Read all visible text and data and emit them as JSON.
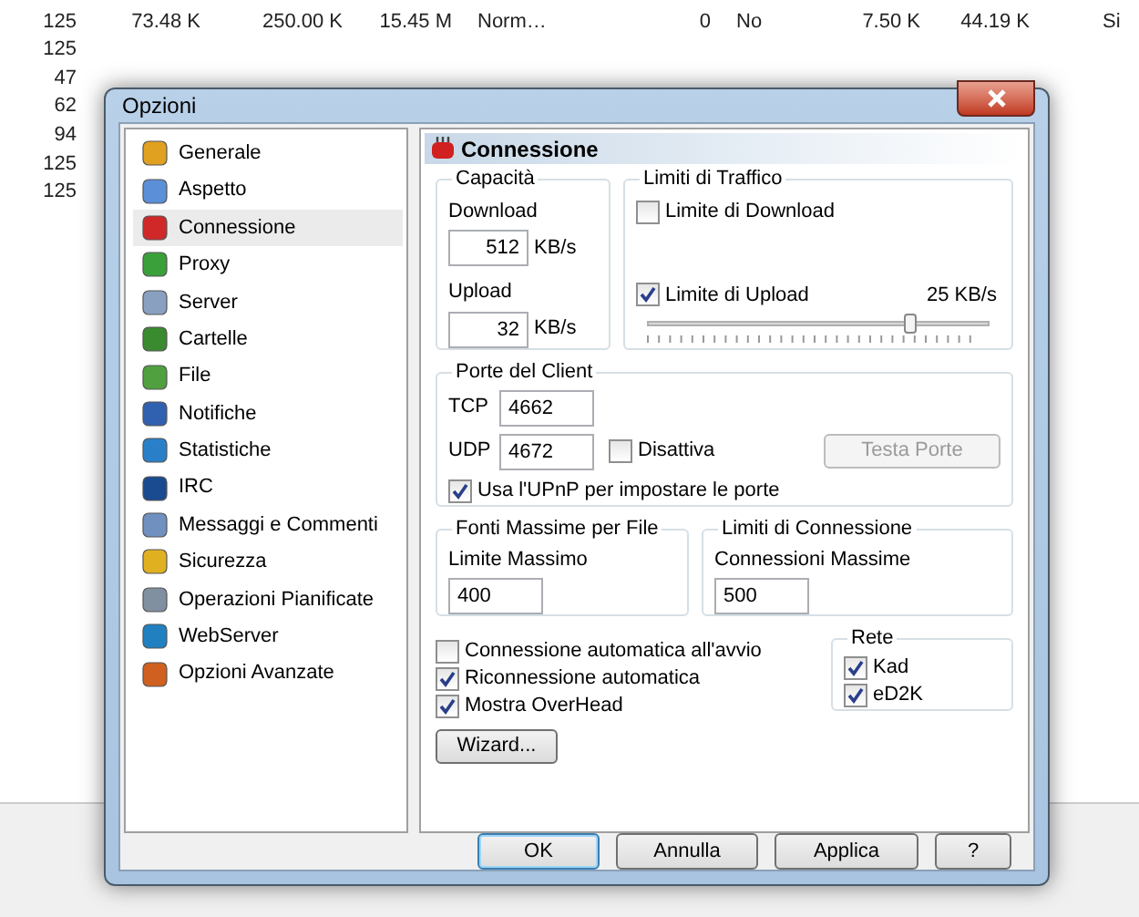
{
  "background_table": {
    "rows": [
      {
        "cells": [
          "125",
          "73.48 K",
          "250.00 K",
          "15.45 M",
          "Norm…",
          "0",
          "No",
          "7.50 K",
          "44.19 K",
          "Si"
        ]
      },
      {
        "cells": [
          "125"
        ]
      },
      {
        "cells": [
          "47"
        ]
      },
      {
        "cells": [
          "62"
        ]
      },
      {
        "cells": [
          "94"
        ]
      },
      {
        "cells": [
          "125"
        ]
      },
      {
        "cells": [
          "125"
        ]
      }
    ]
  },
  "dialog": {
    "title": "Opzioni",
    "sidebar": {
      "items": [
        {
          "label": "Generale",
          "selected": false
        },
        {
          "label": "Aspetto",
          "selected": false
        },
        {
          "label": "Connessione",
          "selected": true
        },
        {
          "label": "Proxy",
          "selected": false
        },
        {
          "label": "Server",
          "selected": false
        },
        {
          "label": "Cartelle",
          "selected": false
        },
        {
          "label": "File",
          "selected": false
        },
        {
          "label": "Notifiche",
          "selected": false
        },
        {
          "label": "Statistiche",
          "selected": false
        },
        {
          "label": "IRC",
          "selected": false
        },
        {
          "label": "Messaggi e Commenti",
          "selected": false
        },
        {
          "label": "Sicurezza",
          "selected": false
        },
        {
          "label": "Operazioni Pianificate",
          "selected": false
        },
        {
          "label": "WebServer",
          "selected": false
        },
        {
          "label": "Opzioni Avanzate",
          "selected": false
        }
      ]
    },
    "panel": {
      "title": "Connessione",
      "capacity": {
        "title": "Capacità",
        "download_label": "Download",
        "download_value": "512",
        "download_unit": "KB/s",
        "upload_label": "Upload",
        "upload_value": "32",
        "upload_unit": "KB/s"
      },
      "traffic_limits": {
        "title": "Limiti di Traffico",
        "download_limit": {
          "label": "Limite di Download",
          "checked": false
        },
        "upload_limit": {
          "label": "Limite di Upload",
          "checked": true,
          "reading": "25 KB/s",
          "level": 0.77
        }
      },
      "client_ports": {
        "title": "Porte del Client",
        "tcp_label": "TCP",
        "tcp_value": "4662",
        "udp_label": "UDP",
        "udp_value": "4672",
        "disable": {
          "label": "Disattiva",
          "checked": false
        },
        "test_button": {
          "label": "Testa Porte",
          "disabled": true
        },
        "upnp": {
          "label": "Usa l'UPnP per impostare le porte",
          "checked": true
        }
      },
      "max_sources": {
        "title": "Fonti Massime per File",
        "label": "Limite Massimo",
        "value": "400"
      },
      "connection_limits": {
        "title": "Limiti di Connessione",
        "label": "Connessioni Massime",
        "value": "500"
      },
      "options": [
        {
          "label": "Connessione automatica all'avvio",
          "checked": false
        },
        {
          "label": "Riconnessione automatica",
          "checked": true
        },
        {
          "label": "Mostra OverHead",
          "checked": true
        }
      ],
      "network": {
        "title": "Rete",
        "items": [
          {
            "label": "Kad",
            "checked": true
          },
          {
            "label": "eD2K",
            "checked": true
          }
        ]
      },
      "wizard_button": "Wizard..."
    },
    "buttons": [
      {
        "label": "OK",
        "default": true
      },
      {
        "label": "Annulla",
        "default": false
      },
      {
        "label": "Applica",
        "default": false
      },
      {
        "label": "?",
        "default": false
      }
    ]
  }
}
